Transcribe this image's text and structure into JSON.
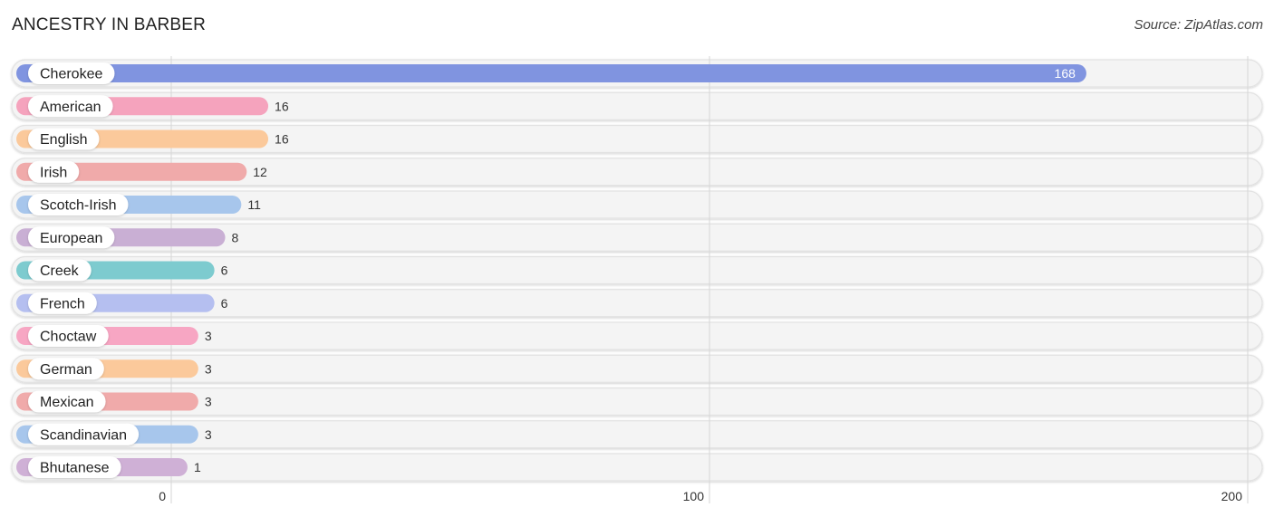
{
  "header": {
    "title": "ANCESTRY IN BARBER",
    "source": "Source: ZipAtlas.com"
  },
  "chart_data": {
    "type": "bar",
    "orientation": "horizontal",
    "title": "ANCESTRY IN BARBER",
    "xlabel": "",
    "ylabel": "",
    "xlim": [
      0,
      200
    ],
    "xticks": [
      0,
      100,
      200
    ],
    "xtick_labels": [
      "0",
      "100",
      "200"
    ],
    "grid": true,
    "categories": [
      "Cherokee",
      "American",
      "English",
      "Irish",
      "Scotch-Irish",
      "European",
      "Creek",
      "French",
      "Choctaw",
      "German",
      "Mexican",
      "Scandinavian",
      "Bhutanese"
    ],
    "values": [
      168,
      16,
      16,
      12,
      11,
      8,
      6,
      6,
      3,
      3,
      3,
      3,
      1
    ],
    "value_labels": [
      "168",
      "16",
      "16",
      "12",
      "11",
      "8",
      "6",
      "6",
      "3",
      "3",
      "3",
      "3",
      "1"
    ],
    "colors": [
      "#8094e0",
      "#f5a3bd",
      "#fbc99b",
      "#f0aaaa",
      "#a7c6ec",
      "#c9afd4",
      "#7dcbcf",
      "#b5bff0",
      "#f7a6c3",
      "#fbc99b",
      "#f0aaaa",
      "#a7c6ec",
      "#cfb0d6"
    ]
  }
}
